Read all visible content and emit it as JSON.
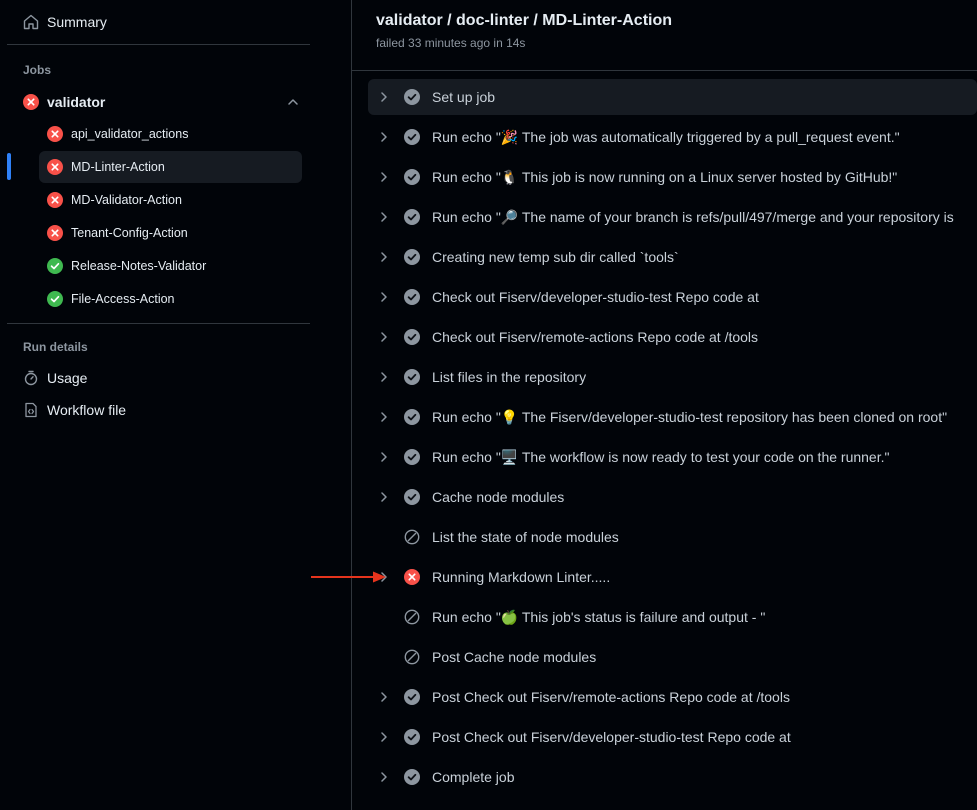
{
  "sidebar": {
    "summary_label": "Summary",
    "jobs_title": "Jobs",
    "job": {
      "name": "validator",
      "status": "failed",
      "subjobs": [
        {
          "name": "api_validator_actions",
          "status": "failed",
          "active": false
        },
        {
          "name": "MD-Linter-Action",
          "status": "failed",
          "active": true
        },
        {
          "name": "MD-Validator-Action",
          "status": "failed",
          "active": false
        },
        {
          "name": "Tenant-Config-Action",
          "status": "failed",
          "active": false
        },
        {
          "name": "Release-Notes-Validator",
          "status": "success",
          "active": false
        },
        {
          "name": "File-Access-Action",
          "status": "success",
          "active": false
        }
      ]
    },
    "run_details_title": "Run details",
    "usage_label": "Usage",
    "workflow_file_label": "Workflow file"
  },
  "main": {
    "title": "validator / doc-linter / MD-Linter-Action",
    "subtitle": "failed 33 minutes ago in 14s",
    "steps": [
      {
        "label": "Set up job",
        "status": "success",
        "expandable": true
      },
      {
        "label": "Run echo \"🎉 The job was automatically triggered by a pull_request event.\"",
        "status": "success",
        "expandable": true
      },
      {
        "label": "Run echo \"🐧 This job is now running on a Linux server hosted by GitHub!\"",
        "status": "success",
        "expandable": true
      },
      {
        "label": "Run echo \"🔎 The name of your branch is refs/pull/497/merge and your repository is",
        "status": "success",
        "expandable": true
      },
      {
        "label": "Creating new temp sub dir called `tools`",
        "status": "success",
        "expandable": true
      },
      {
        "label": "Check out Fiserv/developer-studio-test Repo code at",
        "status": "success",
        "expandable": true
      },
      {
        "label": "Check out Fiserv/remote-actions Repo code at /tools",
        "status": "success",
        "expandable": true
      },
      {
        "label": "List files in the repository",
        "status": "success",
        "expandable": true
      },
      {
        "label": "Run echo \"💡 The Fiserv/developer-studio-test repository has been cloned on root\"",
        "status": "success",
        "expandable": true
      },
      {
        "label": "Run echo \"🖥️ The workflow is now ready to test your code on the runner.\"",
        "status": "success",
        "expandable": true
      },
      {
        "label": "Cache node modules",
        "status": "success",
        "expandable": true
      },
      {
        "label": "List the state of node modules",
        "status": "skipped",
        "expandable": false
      },
      {
        "label": "Running Markdown Linter.....",
        "status": "failed",
        "expandable": true
      },
      {
        "label": "Run echo \"🍏 This job's status is failure and output - \"",
        "status": "skipped",
        "expandable": false
      },
      {
        "label": "Post Cache node modules",
        "status": "skipped",
        "expandable": false
      },
      {
        "label": "Post Check out Fiserv/remote-actions Repo code at /tools",
        "status": "success",
        "expandable": true
      },
      {
        "label": "Post Check out Fiserv/developer-studio-test Repo code at",
        "status": "success",
        "expandable": true
      },
      {
        "label": "Complete job",
        "status": "success",
        "expandable": true
      }
    ]
  },
  "colors": {
    "failed": "#f85149",
    "success": "#3fb950",
    "step_success": "#8d96a0",
    "accent": "#2f81f7",
    "annotation_arrow": "#e5341d"
  }
}
